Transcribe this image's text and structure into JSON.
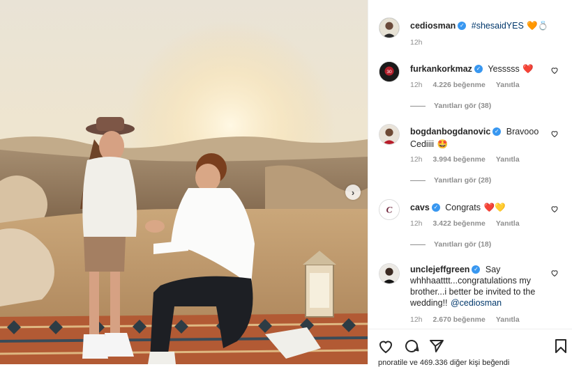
{
  "caption": {
    "username": "cediosman",
    "text": "#shesaidYES",
    "emoji": "🧡💍",
    "time": "12h"
  },
  "comments": [
    {
      "username": "furkankorkmaz",
      "text": "Yesssss",
      "emoji": "❤️",
      "time": "12h",
      "likes": "4.226 beğenme",
      "reply": "Yanıtla",
      "replies": "Yanıtları gör (38)"
    },
    {
      "username": "bogdanbogdanovic",
      "text": "Bravooo",
      "text2": "Cediiii",
      "emoji": "🤩",
      "time": "12h",
      "likes": "3.994 beğenme",
      "reply": "Yanıtla",
      "replies": "Yanıtları gör (28)"
    },
    {
      "username": "cavs",
      "text": "Congrats",
      "emoji": "❤️💛",
      "time": "12h",
      "likes": "3.422 beğenme",
      "reply": "Yanıtla",
      "replies": "Yanıtları gör (18)"
    },
    {
      "username": "unclejeffgreen",
      "text": "Say",
      "text2": "whhhaatttt...congratulations my",
      "text3": "brother...i better be invited to the",
      "text4": "wedding!!",
      "mention": "@cediosman",
      "time": "12h",
      "likes": "2.670 beğenme",
      "reply": "Yanıtla"
    }
  ],
  "footer": {
    "liked_text": "pnoratile ve 469.336 diğer kişi beğendi"
  },
  "icons": {
    "like": "heart-outline-icon",
    "comment": "comment-bubble-icon",
    "share": "paper-plane-icon",
    "save": "bookmark-icon",
    "next": "chevron-right-icon",
    "verified": "verified-badge-icon"
  },
  "colors": {
    "verified": "#3897f0",
    "link": "#00376b",
    "muted": "#8e8e8e"
  }
}
